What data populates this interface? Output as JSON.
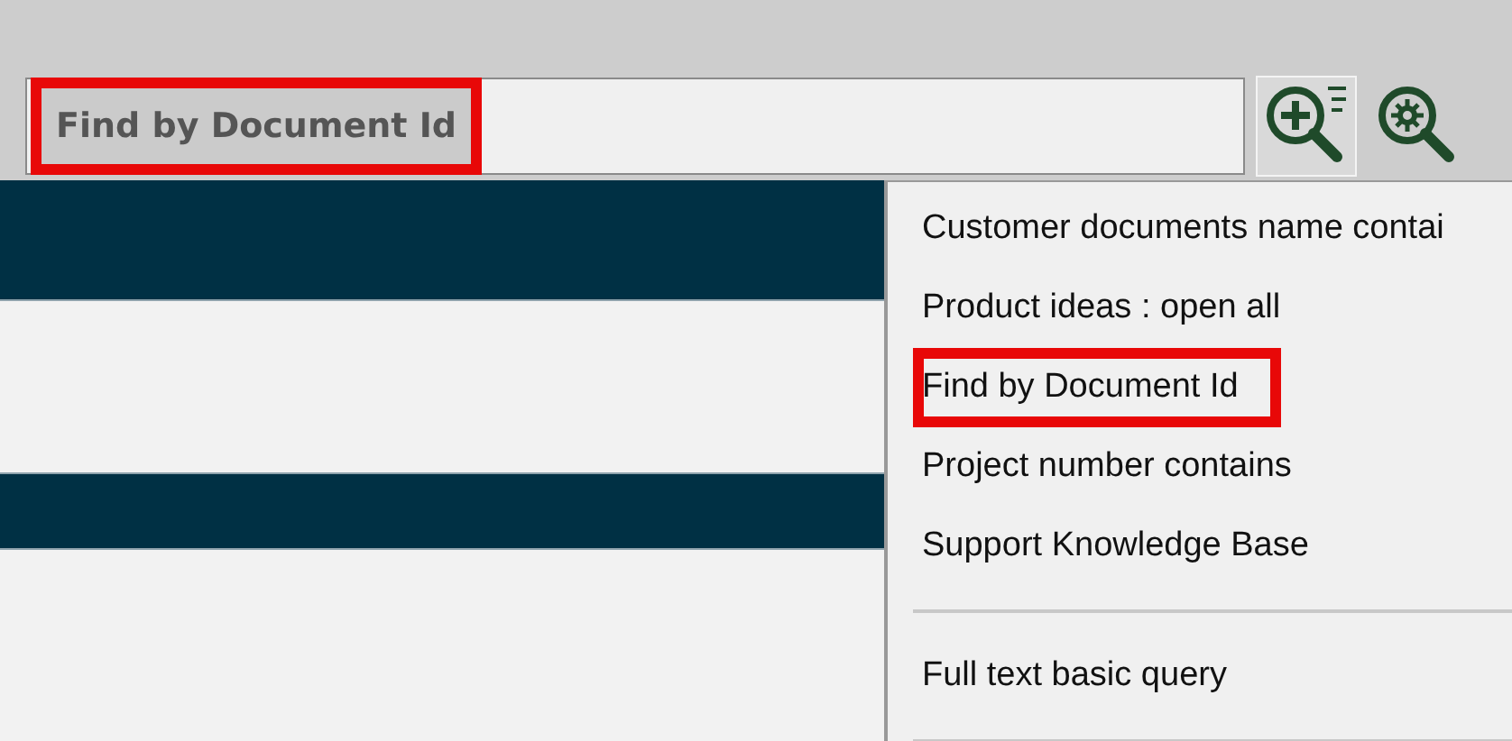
{
  "search": {
    "value": "Find by Document Id",
    "highlighted": true
  },
  "toolbar": {
    "add_query_selected": true
  },
  "list_rows": [
    {
      "selected": true
    },
    {
      "selected": false
    },
    {
      "selected": true
    },
    {
      "selected": false
    }
  ],
  "menu": {
    "items": [
      {
        "kind": "item",
        "label": "Customer documents name contai",
        "highlighted": false
      },
      {
        "kind": "item",
        "label": "Product ideas : open all",
        "highlighted": false
      },
      {
        "kind": "item",
        "label": "Find by Document Id",
        "highlighted": true
      },
      {
        "kind": "item",
        "label": "Project number contains",
        "highlighted": false
      },
      {
        "kind": "item",
        "label": "Support Knowledge Base",
        "highlighted": false
      },
      {
        "kind": "separator"
      },
      {
        "kind": "item",
        "label": "Full text basic query",
        "highlighted": false
      },
      {
        "kind": "separator"
      }
    ]
  }
}
